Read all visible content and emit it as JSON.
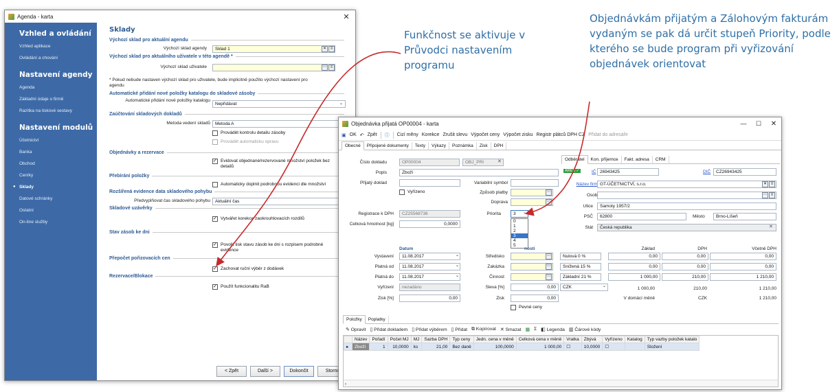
{
  "agenda_window": {
    "title": "Agenda - karta",
    "sidebar": {
      "section1": "Vzhled a ovládání",
      "items1": [
        "Vzhled aplikace",
        "Ovládání a chování"
      ],
      "section2": "Nastavení agendy",
      "items2": [
        "Agenda",
        "Základní údaje o firmě",
        "Razítka na tiskové sestavy"
      ],
      "section3": "Nastavení modulů",
      "items3": [
        "Účetnictví",
        "Banka",
        "Obchod",
        "Ceníky",
        "Sklady",
        "Datové schránky",
        "Ostatní",
        "On-line služby"
      ],
      "active": "Sklady"
    },
    "heading": "Sklady",
    "sections": {
      "s1": "Výchozí sklad pro aktuální agendu",
      "s2": "Výchozí sklad pro aktuálního uživatele v této agendě *",
      "s3": "Automatické přidání nové položky katalogu do skladové zásoby",
      "s4": "Zaúčtování skladových dokladů",
      "s5": "Objednávky a rezervace",
      "s6": "Přebírání položky",
      "s7": "Rozšířená evidence data skladového pohybu",
      "s8": "Skladové uzávěrky",
      "s9": "Stav zásob ke dni",
      "s10": "Přepočet pořizovacích cen",
      "s11": "Rezervace/Blokace"
    },
    "fields": {
      "agenda_store_label": "Výchozí sklad agendy",
      "agenda_store_value": "Sklad 1",
      "user_store_label": "Výchozí sklad uživatele",
      "user_store_value": "",
      "note": "* Pokud nebude nastaven výchozí sklad pro uživatele, bude implicitně použito výchozí nastavení pro agendu",
      "auto_add_label": "Automatické přidání nové položky katalogu",
      "auto_add_value": "Nepřidávat",
      "method_label": "Metoda vedení skladů",
      "method_value": "Metoda A",
      "date_label": "Předvyplňovat čas skladového pohybu",
      "date_value": "Aktuální čas"
    },
    "checks": {
      "c1": "Provádět kontrolu detailu zásoby",
      "c2": "Provádět automaticku opravu",
      "c3": "Evidovat objednané/rezervované množství položek bez detailů",
      "c4": "Automaticky doplnit podrobnou evidenci dle množství",
      "c5": "Vytvářet korekce zaokrouhlovacích rozdílů",
      "c6": "Povolit tisk stavu zásob ke dni s rozpisem podrobné evidence",
      "c7": "Zachovat ruční výběr z dodávek",
      "c8": "Použít funkcionalitu RaB"
    },
    "buttons": {
      "back": "< Zpět",
      "next": "Další >",
      "finish": "Dokončit",
      "cancel": "Storno"
    }
  },
  "callouts": {
    "left": "Funkčnost se aktivuje v Průvodci nastavením programu",
    "right": "Objednávkám přijatým a Zálohovým fakturám vydaným se pak dá určit stupeň Priority, podle kterého se bude program při vyřizování objednávek orientovat"
  },
  "order_window": {
    "title": "Objednávka přijatá OP00004 - karta",
    "toolbar": [
      "OK",
      "Zpět",
      "Cizí měny",
      "Korekce",
      "Zrušit slevu",
      "Výpočet ceny",
      "Výpočet zisku",
      "Registr plátců DPH CZ",
      "Přidat do adresáře"
    ],
    "tabs": [
      "Obecné",
      "Připojené dokumenty",
      "Texty",
      "Výkazy",
      "Poznámka",
      "Zisk",
      "DPH"
    ],
    "fields": {
      "doc_no_label": "Číslo dokladu",
      "doc_no": "OP00004",
      "doc_series": "OBJ_PRI",
      "popis_label": "Popis",
      "popis": "Zboží",
      "recv_label": "Přijatý doklad",
      "vyrizeno": "Vyřízeno",
      "vs_label": "Variabilní symbol",
      "payment_label": "Způsob platby",
      "transport_label": "Doprava",
      "dph_reg_label": "Registrace k DPH",
      "dph_reg": "CZ25568736",
      "weight_label": "Celková hmotnost [kg]",
      "weight": "0,0000",
      "priority_label": "Priorita",
      "priority": "3",
      "priority_options": [
        "0",
        "1",
        "2",
        "3",
        "4",
        "5"
      ]
    },
    "partner_tabs": [
      "Odběratel",
      "Kon. příjemce",
      "Fakt. adresa",
      "CRM"
    ],
    "partner": {
      "ares": "ARES ✓",
      "ic_label": "IČ",
      "ic": "26943425",
      "dic_label": "DIČ",
      "dic": "CZ26943425",
      "firm_label": "Název firmy",
      "firm": "GT-ÚČETNICTVÍ, s.r.o.",
      "person_label": "Osoba",
      "street_label": "Ulice",
      "street": "Samoty 1957/2",
      "psc_label": "PSČ",
      "psc": "62800",
      "city_label": "Město",
      "city": "Brno-Líšeň",
      "state_label": "Stát",
      "state": "Česká republika"
    },
    "dates": {
      "heading": "Datum",
      "issued_label": "Vystavení",
      "issued": "11.08.2017",
      "valid_from_label": "Platná od",
      "valid_from": "11.08.2017",
      "valid_to_label": "Platná do",
      "valid_to": "11.08.2017",
      "resolve_label": "Vyřízení",
      "resolve": "nezadáno",
      "profit_label": "Zisk [%]",
      "profit": "0,00"
    },
    "mid": {
      "heading": "nosti",
      "centre_label": "Středisko",
      "order_label": "Zakázka",
      "activity_label": "Činnost",
      "discount_label": "Sleva [%]",
      "discount": "0,00",
      "currency": "CZK",
      "zisk_label": "Zisk",
      "zisk": "0,00",
      "fixed_prices": "Pevné ceny"
    },
    "vat": {
      "headers": [
        "Základ",
        "DPH",
        "Včetně DPH"
      ],
      "rows": [
        {
          "rate": "Nulová 0 %",
          "base": "0,00",
          "vat": "0,00",
          "total": "0,00"
        },
        {
          "rate": "Snížená 15 %",
          "base": "0,00",
          "vat": "0,00",
          "total": "0,00"
        },
        {
          "rate": "Základní 21 %",
          "base": "1 000,00",
          "vat": "210,00",
          "total": "1 210,00"
        }
      ],
      "sum": {
        "base": "1 000,00",
        "vat": "210,00",
        "total": "1 210,00"
      },
      "domestic_label": "V domácí měně",
      "domestic_cur": "CZK",
      "domestic_total": "1 210,00"
    },
    "items_tabs": [
      "Položky",
      "Poplatky"
    ],
    "items_toolbar": [
      "Opravit",
      "Přidat dokladem",
      "Přidat výběrem",
      "Přidat",
      "Kopírovat",
      "Smazat",
      "Σ",
      "Legenda",
      "Čárové kódy"
    ],
    "items_headers": [
      "Název",
      "Pořadí",
      "Počet MJ",
      "MJ",
      "Sazba DPH",
      "Typ ceny",
      "Jedn. cena v měně",
      "Celková cena v měně",
      "Vratka",
      "Zbývá",
      "Vyřízeno",
      "Katalog",
      "Typ vazby položek katalo"
    ],
    "items": [
      {
        "name": "Zboží",
        "order": "1",
        "qty": "10,0000",
        "unit": "ks",
        "rate": "21,00",
        "price_type": "Bez daně",
        "unit_price": "100,0000",
        "total": "1 000,00",
        "left": "10,0000",
        "link_type": "Složení"
      }
    ]
  }
}
